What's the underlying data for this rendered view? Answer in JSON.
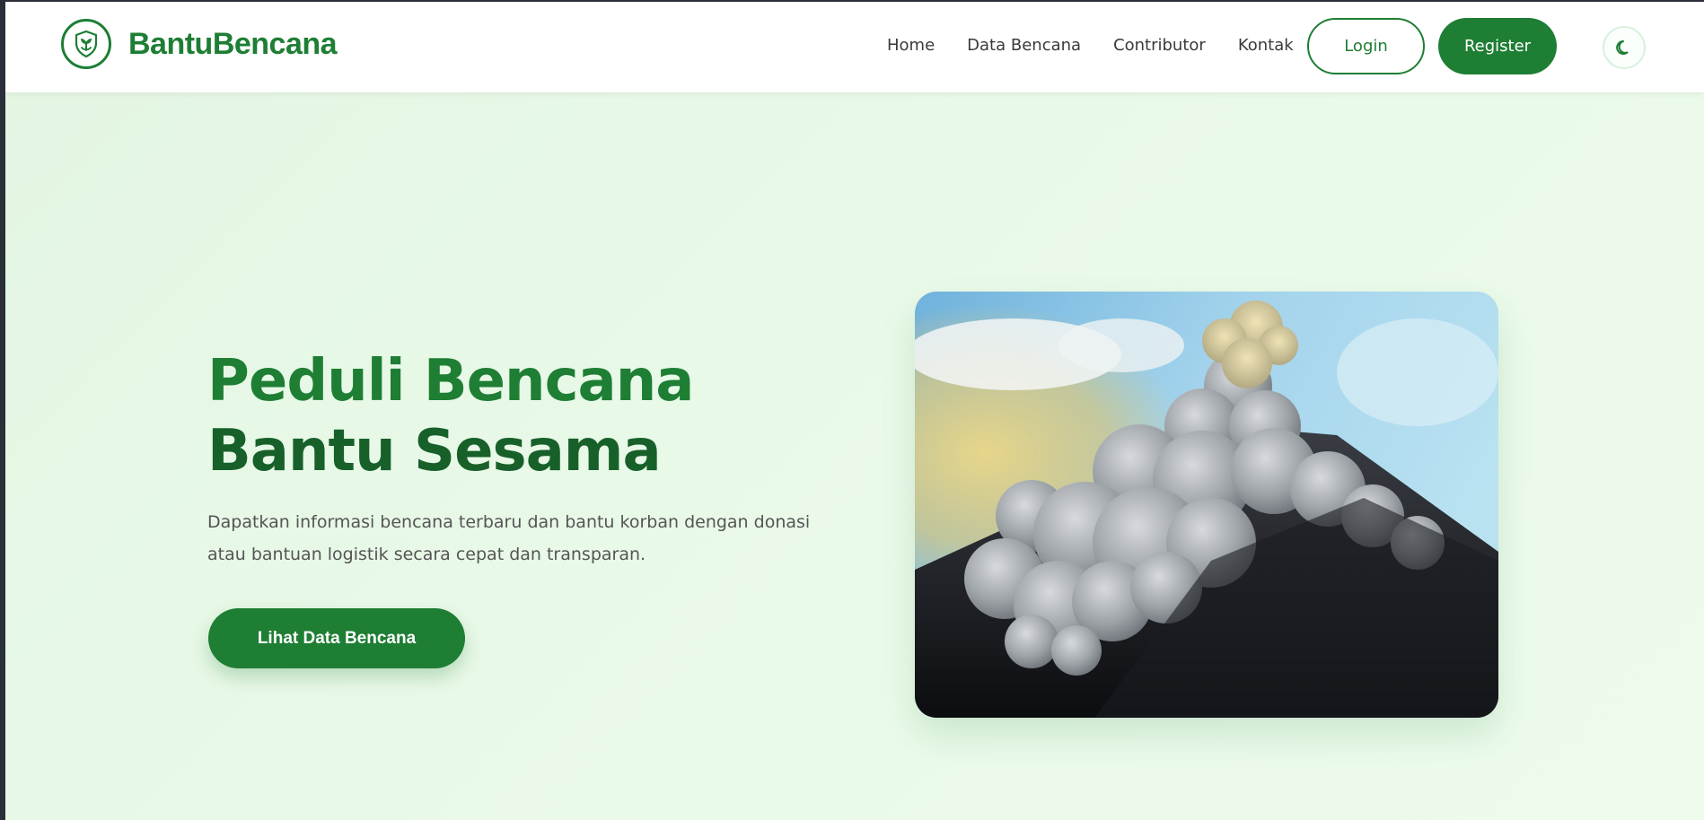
{
  "brand": {
    "name": "BantuBencana",
    "icon": "shield-leaf-icon",
    "color": "#1e7e34"
  },
  "nav": {
    "links": [
      "Home",
      "Data Bencana",
      "Contributor",
      "Kontak"
    ],
    "login_label": "Login",
    "register_label": "Register",
    "theme_icon": "moon-icon"
  },
  "hero": {
    "title_line1": "Peduli Bencana",
    "title_line2": "Bantu Sesama",
    "description": "Dapatkan informasi bencana terbaru dan bantu korban dengan donasi atau bantuan logistik secara cepat dan transparan.",
    "cta_label": "Lihat Data Bencana",
    "image": "volcano-eruption-photo"
  },
  "colors": {
    "primary": "#1e7e34",
    "primary_dark": "#17602a",
    "background": "#e9f9e8"
  }
}
